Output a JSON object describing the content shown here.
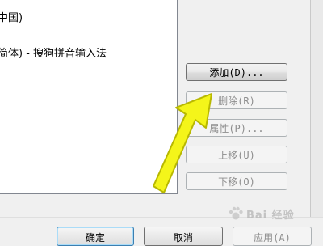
{
  "list": {
    "items": [
      "中国)",
      "简体) - 搜狗拼音输入法"
    ]
  },
  "buttons": {
    "add": "添加(D)...",
    "remove": "删除(R)",
    "properties": "属性(P)...",
    "move_up": "上移(U)",
    "move_down": "下移(O)"
  },
  "footer": {
    "ok": "确定",
    "cancel": "取消",
    "apply": "应用(A)"
  },
  "watermark": {
    "text": "Bai 经验"
  },
  "colors": {
    "arrow_fill": "#f4f51a",
    "arrow_stroke": "#b8b800"
  }
}
